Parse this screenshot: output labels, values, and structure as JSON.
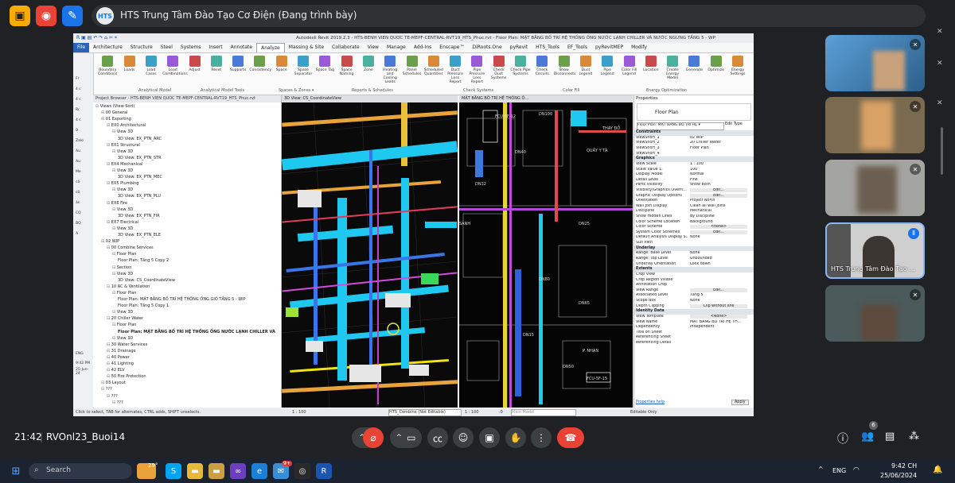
{
  "meet": {
    "presenter_avatar": "HTS",
    "presenter_title": "HTS Trung Tâm Đào Tạo Cơ Điện (Đang trình bày)",
    "clock": "21:42",
    "meeting_code": "RVOnl23_Buoi14",
    "participant_count": "6",
    "self_tile_name": "HTS Trung Tâm Đào Tạo ..."
  },
  "revit": {
    "title": "Autodesk Revit 2019.2.3 - HTS-BENH VIEN QUOC TE-MEPF-CENTRAL-RVT19_HTS_Phuc.rvt - Floor Plan: MẶT BẰNG BỐ TRÍ HỆ THỐNG ỐNG NƯỚC LẠNH CHILLER VÀ NƯỚC NGƯNG TẦNG 5 - WP",
    "tabs": [
      "File",
      "Architecture",
      "Structure",
      "Steel",
      "Systems",
      "Insert",
      "Annotate",
      "Analyze",
      "Massing & Site",
      "Collaborate",
      "View",
      "Manage",
      "Add-Ins",
      "Enscape™",
      "DiRoots.One",
      "pyRevit",
      "HTS_Tools",
      "EF_Tools",
      "pyRevitMEP",
      "Modify"
    ],
    "active_tab": "Analyze",
    "ribbon_buttons": [
      "Modify",
      "Boundary Conditions",
      "Loads",
      "Load Cases",
      "Load Combinations",
      "Adjust",
      "Reset",
      "Supports",
      "Consistency",
      "Space",
      "Space Separator",
      "Space Tag",
      "Space Naming",
      "Zone",
      "Heating and Cooling Loads",
      "Panel Schedules",
      "Scheduled Quantities",
      "Duct Pressure Loss Report",
      "Pipe Pressure Loss Report",
      "Check Duct Systems",
      "Check Pipe Systems",
      "Check Circuits",
      "Show Disconnects",
      "Duct Legend",
      "Pipe Legend",
      "Color Fill Legend",
      "Location",
      "Create Energy Model",
      "Generate",
      "Optimize",
      "Energy Settings"
    ],
    "ribbon_groups": [
      "Select ▾",
      "Analytical Model",
      "Analytical Model Tools",
      "Spaces & Zones ▾",
      "Reports & Schedules",
      "Check Systems",
      "Color Fill",
      "Energy Optimization"
    ],
    "project_browser_title": "Project Browser - HTS-BENH VIEN QUOC TE-MEPF-CENTRAL-RVT19_HTS_Phuc.rvt",
    "tree": [
      "Views (View Sort)",
      "00 General",
      "01 Exporting",
      "EX0 Architectural",
      "View 3D",
      "3D View: EX_PTN_ARC",
      "EX1 Structural",
      "View 3D",
      "3D View: EX_PTN_STR",
      "EX4 Mechanical",
      "View 3D",
      "3D View: EX_PTN_MEC",
      "EX5 Plumbing",
      "View 3D",
      "3D View: EX_PTN_PLU",
      "EX6 Fire",
      "View 3D",
      "3D View: EX_PTN_FIR",
      "EX7 Electrical",
      "View 3D",
      "3D View: EX_PTN_ELE",
      "02 WIP",
      "00 Combine Services",
      "Floor Plan",
      "Floor Plan: Tầng 5 Copy 2",
      "Section",
      "View 3D",
      "3D View: CS_CoordinateView",
      "10 AC & Ventilation",
      "Floor Plan",
      "Floor Plan: MẶT BẰNG BỐ TRÍ HỆ THỐNG ỐNG GIÓ TẦNG 5 - WIP",
      "Floor Plan: Tầng 5 Copy 1",
      "View 3D",
      "20 Chiller Water",
      "Floor Plan",
      "Floor Plan: MẶT BẰNG BỐ TRÍ HỆ THỐNG ỐNG NƯỚC LẠNH CHILLER VÀ",
      "View 3D",
      "30 Water Services",
      "31 Drainage",
      "40 Power",
      "41 Lighting",
      "42 ELV",
      "50 Fire Protection",
      "03 Layout",
      "???",
      "???",
      "???"
    ],
    "view_tabs": [
      "3D View: CS_CoordinateView",
      "MẶT BẰNG BỐ TRÍ HỆ THỐNG Ố..."
    ],
    "plan_texts": [
      "DN100",
      "DN32",
      "DN40",
      "DN25",
      "DN80",
      "DN65",
      "QUẦY Y TÁ",
      "THAY ĐỒ",
      "SẢNH",
      "P. NHAN",
      "DN15",
      "DN50",
      "FCU-5F-12",
      "FCU-5F-15"
    ],
    "properties": {
      "title": "Properties",
      "type": "Floor Plan",
      "selector": "Floor Plan: MẶT BẰNG BỐ TRÍ HỆ ▾",
      "edit_type": "Edit Type",
      "sections": [
        {
          "name": "Constraints",
          "rows": [
            [
              "ViewShort_1",
              "02 WIP"
            ],
            [
              "ViewShort_2",
              "20 Chiller Water"
            ],
            [
              "ViewShort_3",
              "Floor Plan"
            ],
            [
              "ViewShort_4",
              ""
            ]
          ]
        },
        {
          "name": "Graphics",
          "rows": [
            [
              "View Scale",
              "1 : 100"
            ],
            [
              "Scale Value  1:",
              "100"
            ],
            [
              "Display Model",
              "Normal"
            ],
            [
              "Detail Level",
              "Fine"
            ],
            [
              "Parts Visibility",
              "Show Both"
            ],
            [
              "Visibility/Graphics Overri...",
              "Edit..."
            ],
            [
              "Graphic Display Options",
              "Edit..."
            ],
            [
              "Orientation",
              "Project North"
            ],
            [
              "Wall Join Display",
              "Clean all wall joins"
            ],
            [
              "Discipline",
              "Mechanical"
            ],
            [
              "Show Hidden Lines",
              "By Discipline"
            ],
            [
              "Color Scheme Location",
              "Background"
            ],
            [
              "Color Scheme",
              "<none>"
            ],
            [
              "System Color Schemes",
              "Edit..."
            ],
            [
              "Default Analysis Display S...",
              "None"
            ],
            [
              "Sun Path",
              ""
            ]
          ]
        },
        {
          "name": "Underlay",
          "rows": [
            [
              "Range: Base Level",
              "None"
            ],
            [
              "Range: Top Level",
              "Unbounded"
            ],
            [
              "Underlay Orientation",
              "Look down"
            ]
          ]
        },
        {
          "name": "Extents",
          "rows": [
            [
              "Crop View",
              ""
            ],
            [
              "Crop Region Visible",
              ""
            ],
            [
              "Annotation Crop",
              ""
            ],
            [
              "View Range",
              "Edit..."
            ],
            [
              "Associated Level",
              "Tầng 5"
            ],
            [
              "Scope Box",
              "None"
            ],
            [
              "Depth Clipping",
              "Clip without line"
            ]
          ]
        },
        {
          "name": "Identity Data",
          "rows": [
            [
              "View Template",
              "<None>"
            ],
            [
              "View Name",
              "MẶT BẰNG BỐ TRÍ HỆ TH..."
            ],
            [
              "Dependency",
              "Independent"
            ],
            [
              "Title on Sheet",
              ""
            ],
            [
              "Referencing Sheet",
              ""
            ],
            [
              "Referencing Detail",
              ""
            ]
          ]
        }
      ],
      "help": "Properties help",
      "apply": "Apply"
    },
    "status_text": "Click to select, TAB for alternates, CTRL adds, SHIFT unselects.",
    "status_scale_left": "1 : 100",
    "status_scale_right": "1 : 100",
    "workset": "HTS_Combine (Not Editable)",
    "main_model": "Main Model",
    "editable_only": "Editable Only",
    "zero": ":0",
    "win_clock_time": "9:42 PM",
    "win_clock_date": "25-Jun-24",
    "win_lang": "ENG",
    "win_left_items": [
      "Fl",
      "4 c",
      "4 c",
      "Rr",
      "4 c",
      "0",
      "Zalo",
      "Au",
      "Au",
      "Me",
      "cô",
      "cô",
      "ás",
      "CO",
      "BQ",
      "A"
    ]
  },
  "taskbar": {
    "search": "Search",
    "weather": "29°",
    "lang": "ENG",
    "time": "9:42 CH",
    "date": "25/06/2024",
    "badge": "9+"
  }
}
